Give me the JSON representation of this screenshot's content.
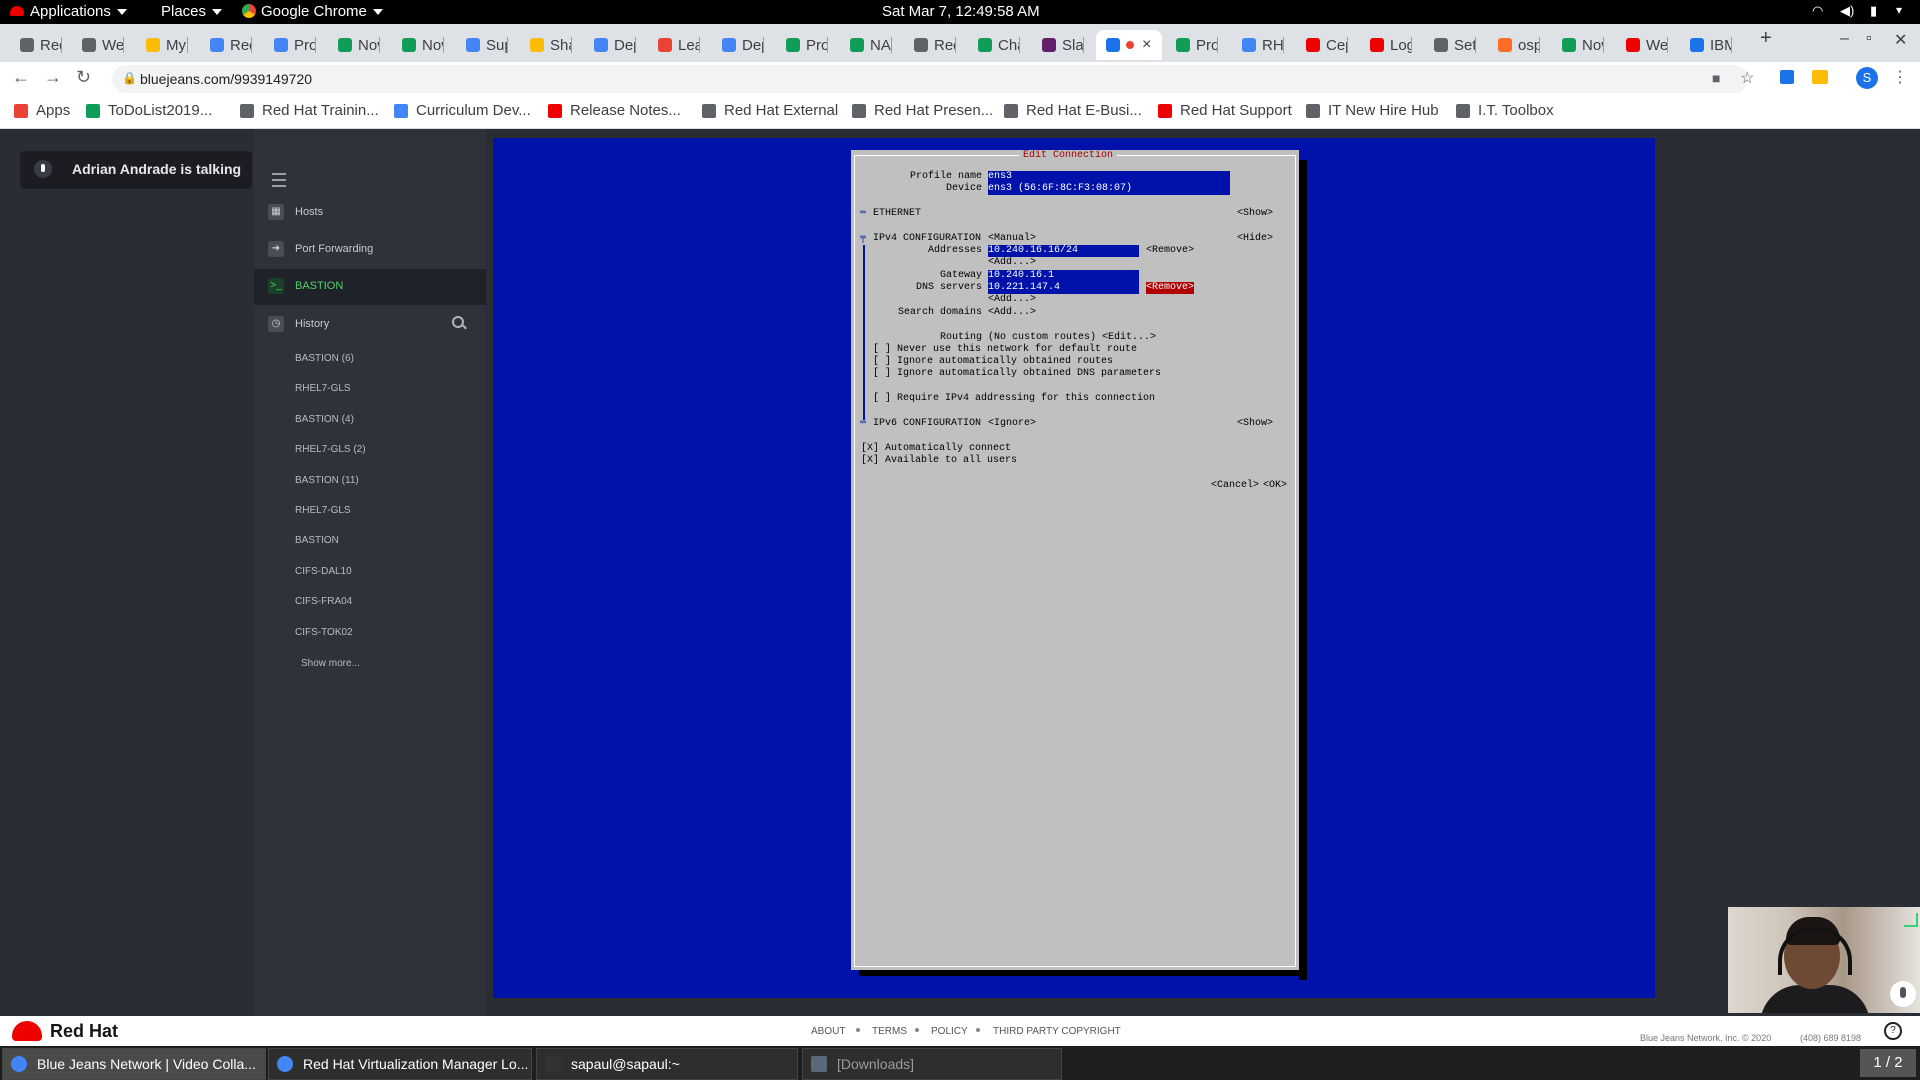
{
  "topbar": {
    "applications": "Applications",
    "places": "Places",
    "chrome": "Google Chrome",
    "clock": "Sat Mar  7, 12:49:58 AM"
  },
  "tabs": [
    {
      "label": "Red",
      "color": "#5f6368"
    },
    {
      "label": "We",
      "color": "#5f6368"
    },
    {
      "label": "My",
      "color": "#fbbc04"
    },
    {
      "label": "Red",
      "color": "#4285f4"
    },
    {
      "label": "Proj",
      "color": "#4285f4"
    },
    {
      "label": "Nov",
      "color": "#0f9d58"
    },
    {
      "label": "Nov",
      "color": "#0f9d58"
    },
    {
      "label": "Sup",
      "color": "#4285f4"
    },
    {
      "label": "Sha",
      "color": "#fbbc04"
    },
    {
      "label": "Dep",
      "color": "#4285f4"
    },
    {
      "label": "Lea",
      "color": "#ea4335"
    },
    {
      "label": "Dep",
      "color": "#4285f4"
    },
    {
      "label": "Proj",
      "color": "#0f9d58"
    },
    {
      "label": "NA",
      "color": "#0f9d58"
    },
    {
      "label": "Red",
      "color": "#5f6368"
    },
    {
      "label": "Cha",
      "color": "#0f9d58"
    },
    {
      "label": "Slac",
      "color": "#611f69"
    },
    {
      "label": "",
      "color": "#1a73e8"
    },
    {
      "label": "Proj",
      "color": "#0f9d58"
    },
    {
      "label": "RHV",
      "color": "#4285f4"
    },
    {
      "label": "Cep",
      "color": "#ee0000"
    },
    {
      "label": "Log",
      "color": "#ee0000"
    },
    {
      "label": "Sett",
      "color": "#5f6368"
    },
    {
      "label": "osp",
      "color": "#fc6d26"
    },
    {
      "label": "Nov",
      "color": "#0f9d58"
    },
    {
      "label": "We",
      "color": "#ee0000"
    },
    {
      "label": "IBM",
      "color": "#1a73e8"
    }
  ],
  "address": {
    "url": "bluejeans.com/9939149720"
  },
  "bookmarks": [
    {
      "label": "Apps",
      "color": "#ea4335"
    },
    {
      "label": "ToDoList2019...",
      "color": "#0f9d58"
    },
    {
      "label": "Red Hat Trainin...",
      "color": "#5f6368"
    },
    {
      "label": "Curriculum Dev...",
      "color": "#4285f4"
    },
    {
      "label": "Release Notes...",
      "color": "#ee0000"
    },
    {
      "label": "Red Hat External",
      "color": "#5f6368"
    },
    {
      "label": "Red Hat Presen...",
      "color": "#5f6368"
    },
    {
      "label": "Red Hat E-Busi...",
      "color": "#5f6368"
    },
    {
      "label": "Red Hat Support",
      "color": "#ee0000"
    },
    {
      "label": "IT New Hire Hub",
      "color": "#5f6368"
    },
    {
      "label": "I.T. Toolbox",
      "color": "#5f6368"
    }
  ],
  "bluejeans": {
    "talking": "Adrian Andrade is talking",
    "nav": {
      "hosts": "Hosts",
      "port_forwarding": "Port Forwarding",
      "bastion": "BASTION",
      "history": "History"
    },
    "history_items": [
      "BASTION (6)",
      "RHEL7-GLS",
      "BASTION (4)",
      "RHEL7-GLS (2)",
      "BASTION (11)",
      "RHEL7-GLS",
      "BASTION",
      "CIFS-DAL10",
      "CIFS-FRA04",
      "CIFS-TOK02"
    ],
    "show_more": "Show more..."
  },
  "nmtui": {
    "title": "Edit Connection",
    "profile_label": "Profile name",
    "profile_value": "ens3",
    "device_label": "Device",
    "device_value": "ens3 (56:6F:8C:F3:08:07)",
    "ethernet": "ETHERNET",
    "show1": "<Show>",
    "ipv4_label": "IPv4 CONFIGURATION",
    "ipv4_mode": "<Manual>",
    "hide": "<Hide>",
    "addresses_label": "Addresses",
    "address_value": "10.240.16.16/24",
    "remove1": "<Remove>",
    "add1": "<Add...>",
    "gateway_label": "Gateway",
    "gateway_value": "10.240.16.1",
    "dns_label": "DNS servers",
    "dns_value": "10.221.147.4",
    "remove2": "<Remove>",
    "add2": "<Add...>",
    "search_label": "Search domains",
    "search_add": "<Add...>",
    "routing_label": "Routing",
    "routing_value": "(No custom routes) <Edit...>",
    "cb1": "[ ] Never use this network for default route",
    "cb2": "[ ] Ignore automatically obtained routes",
    "cb3": "[ ] Ignore automatically obtained DNS parameters",
    "cb4": "[ ] Require IPv4 addressing for this connection",
    "ipv6_label": "IPv6 CONFIGURATION",
    "ipv6_mode": "<Ignore>",
    "show2": "<Show>",
    "auto_connect": "[X] Automatically connect",
    "all_users": "[X] Available to all users",
    "cancel": "<Cancel>",
    "ok": "<OK>"
  },
  "footer": {
    "brand": "Red Hat",
    "about": "ABOUT",
    "terms": "TERMS",
    "policy": "POLICY",
    "third_party": "THIRD PARTY COPYRIGHT",
    "copyright": "Blue Jeans Network, Inc. © 2020",
    "phone": "(408) 689 8198"
  },
  "taskbar": {
    "items": [
      {
        "label": "Blue Jeans Network | Video Colla...",
        "color": "#4285f4"
      },
      {
        "label": "Red Hat Virtualization Manager Lo...",
        "color": "#4285f4"
      },
      {
        "label": "sapaul@sapaul:~",
        "color": "#333333"
      },
      {
        "label": "[Downloads]",
        "color": "#5a6a7a"
      }
    ],
    "workspace": "1 / 2"
  }
}
